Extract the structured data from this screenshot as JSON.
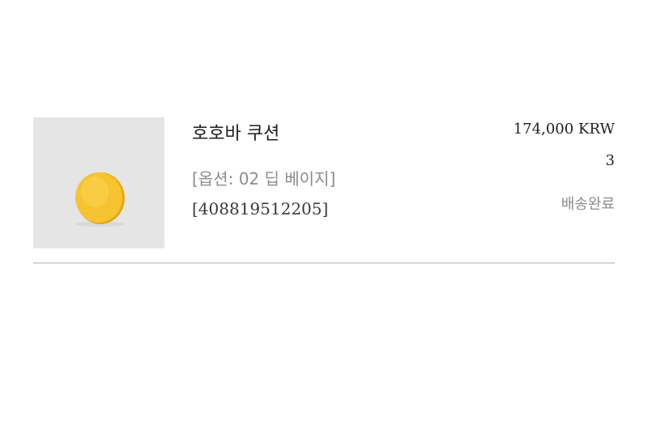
{
  "order_item": {
    "image": {
      "alt": "호호바 쿠션",
      "background_color": "#e5e5e5",
      "product_color": "#f7c331"
    },
    "name": "호호바 쿠션",
    "option": "[옵션: 02 딥 베이지]",
    "code": "[408819512205]",
    "price": "174,000 KRW",
    "quantity": "3",
    "status": "배송완료"
  }
}
